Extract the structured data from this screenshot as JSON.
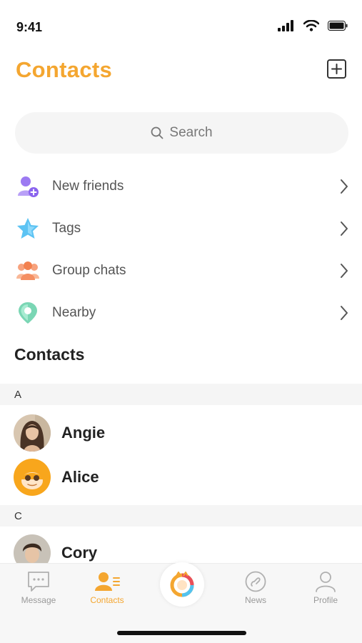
{
  "status": {
    "time": "9:41"
  },
  "header": {
    "title": "Contacts"
  },
  "search": {
    "placeholder": "Search"
  },
  "menu": [
    {
      "label": "New friends",
      "icon": "add-friend-icon"
    },
    {
      "label": "Tags",
      "icon": "star-icon"
    },
    {
      "label": "Group chats",
      "icon": "group-icon"
    },
    {
      "label": "Nearby",
      "icon": "location-pin-icon"
    }
  ],
  "contacts_section": {
    "title": "Contacts"
  },
  "groups": [
    {
      "letter": "A",
      "contacts": [
        "Angie",
        "Alice"
      ]
    },
    {
      "letter": "C",
      "contacts": [
        "Cory"
      ]
    }
  ],
  "tabs": [
    {
      "label": "Message",
      "icon": "message-icon",
      "active": false
    },
    {
      "label": "Contacts",
      "icon": "contacts-icon",
      "active": true
    },
    {
      "label": "News",
      "icon": "news-icon",
      "active": false
    },
    {
      "label": "Profile",
      "icon": "profile-icon",
      "active": false
    }
  ],
  "colors": {
    "accent": "#f4a630",
    "text": "#222222",
    "muted": "#999999"
  }
}
